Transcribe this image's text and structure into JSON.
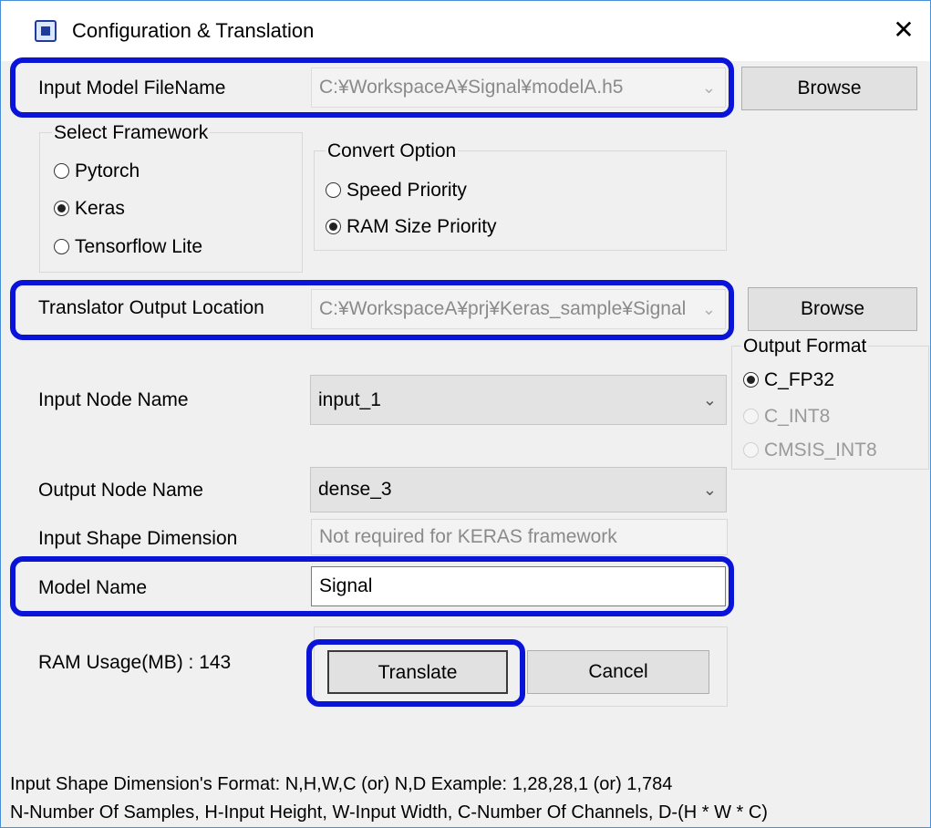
{
  "window": {
    "title": "Configuration & Translation",
    "close_glyph": "✕"
  },
  "input_model": {
    "label": "Input Model FileName",
    "value": "C:¥WorkspaceA¥Signal¥modelA.h5",
    "browse_label": "Browse"
  },
  "framework": {
    "title": "Select Framework",
    "options": [
      "Pytorch",
      "Keras",
      "Tensorflow Lite"
    ],
    "selected": "Keras"
  },
  "convert": {
    "title": "Convert Option",
    "options": [
      "Speed Priority",
      "RAM Size Priority"
    ],
    "selected": "RAM Size Priority"
  },
  "output_location": {
    "label": "Translator Output Location",
    "value": "C:¥WorkspaceA¥prj¥Keras_sample¥Signal",
    "browse_label": "Browse"
  },
  "output_format": {
    "title": "Output Format",
    "options": [
      "C_FP32",
      "C_INT8",
      "CMSIS_INT8"
    ],
    "selected": "C_FP32"
  },
  "input_node": {
    "label": "Input Node Name",
    "value": "input_1"
  },
  "output_node": {
    "label": "Output Node Name",
    "value": "dense_3"
  },
  "input_shape": {
    "label": "Input Shape Dimension",
    "placeholder": "Not required for KERAS framework"
  },
  "model_name": {
    "label": "Model Name",
    "value": "Signal"
  },
  "ram": {
    "label": "RAM Usage(MB) : 143"
  },
  "buttons": {
    "translate": "Translate",
    "cancel": "Cancel"
  },
  "footer": {
    "line1": "Input Shape Dimension's Format: N,H,W,C (or) N,D    Example: 1,28,28,1 (or) 1,784",
    "line2": "N-Number Of Samples, H-Input Height, W-Input Width, C-Number Of Channels, D-(H * W * C)"
  },
  "colors": {
    "highlight": "#0a14d8",
    "dialog_bg": "#f0f0f0"
  }
}
